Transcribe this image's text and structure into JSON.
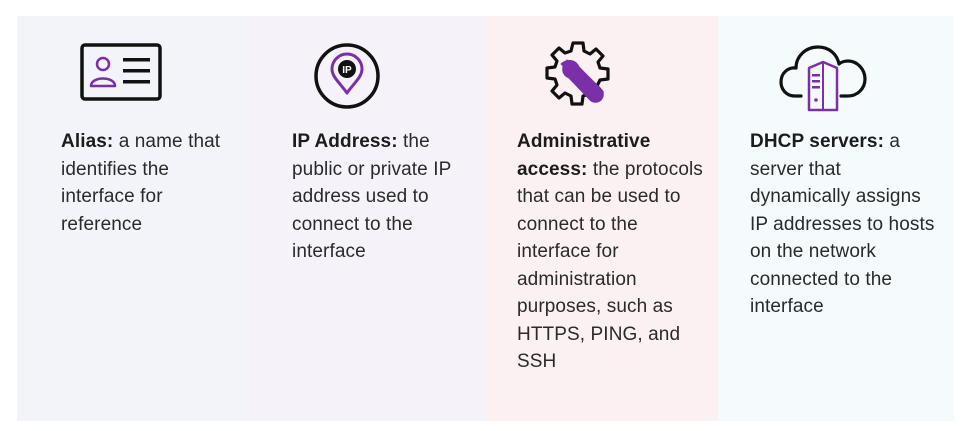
{
  "cards": [
    {
      "icon": "id-card-icon",
      "term": "Alias:",
      "description": " a name that identifies the interface for reference",
      "bg": "#f2f4f9"
    },
    {
      "icon": "location-pin-ip-icon",
      "term": "IP Address:",
      "description": " the public or private IP address used to connect to the interface",
      "bg": "#f5f3f9",
      "icon_text": "IP"
    },
    {
      "icon": "gear-wrench-icon",
      "term": "Administrative access:",
      "description": " the protocols that can be used to connect to the interface for administration purposes, such as HTTPS, PING, and SSH",
      "bg": "#fcf1f2"
    },
    {
      "icon": "cloud-server-icon",
      "term": "DHCP servers:",
      "description": " a server that dynamically assigns IP addresses to hosts on the network connected to the interface",
      "bg": "#f5fbfc"
    }
  ],
  "colors": {
    "accent": "#7b2fa8",
    "outline": "#111111"
  }
}
